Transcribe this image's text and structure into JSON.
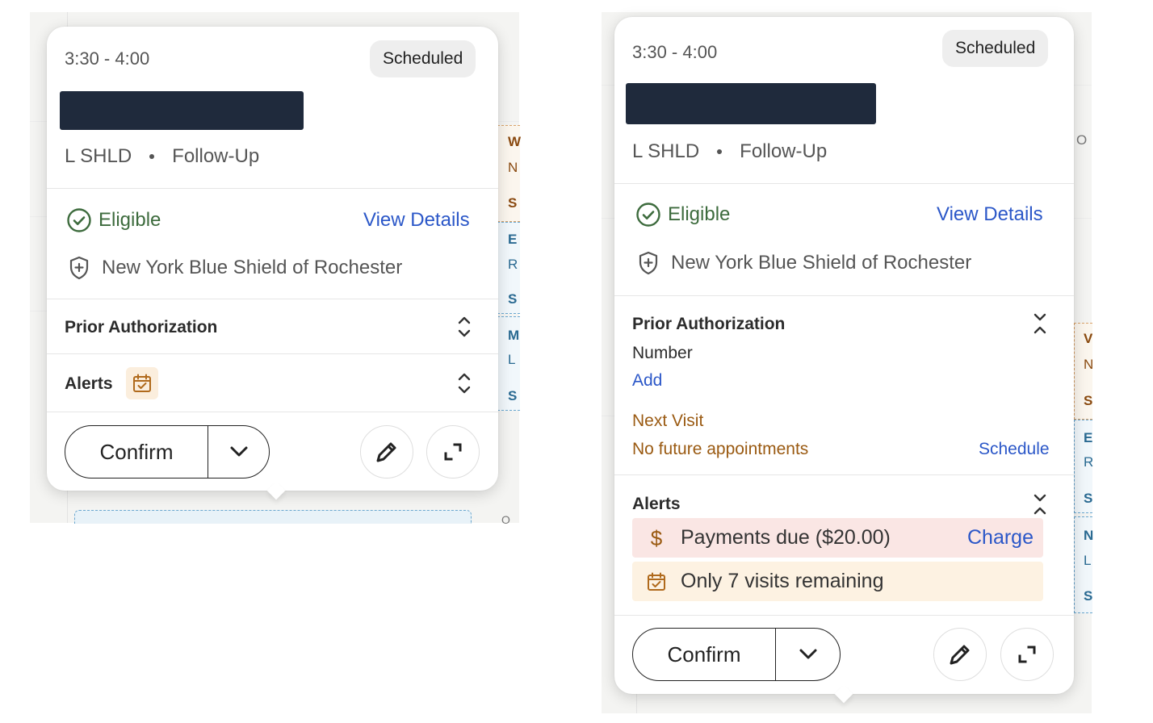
{
  "left_card": {
    "time": "3:30 - 4:00",
    "status": "Scheduled",
    "body_part": "L SHLD",
    "visit_type": "Follow-Up",
    "eligibility": "Eligible",
    "view_details": "View Details",
    "payer": "New York Blue Shield of Rochester",
    "prior_auth_title": "Prior Authorization",
    "alerts_title": "Alerts",
    "confirm_label": "Confirm",
    "expanded": false
  },
  "right_card": {
    "time": "3:30 - 4:00",
    "status": "Scheduled",
    "body_part": "L SHLD",
    "visit_type": "Follow-Up",
    "eligibility": "Eligible",
    "view_details": "View Details",
    "payer": "New York Blue Shield of Rochester",
    "prior_auth_title": "Prior Authorization",
    "number_label": "Number",
    "add_label": "Add",
    "next_visit_label": "Next Visit",
    "next_visit_value": "No future appointments",
    "schedule_label": "Schedule",
    "alerts_title": "Alerts",
    "payment_alert": "Payments due ($20.00)",
    "charge_label": "Charge",
    "visits_alert": "Only 7 visits remaining",
    "confirm_label": "Confirm",
    "expanded": true
  },
  "background_fragments": {
    "left": [
      "W",
      "N",
      "S",
      "E",
      "R",
      "S",
      "M",
      "L",
      "S"
    ],
    "left_bottom": "O",
    "right_top": "O",
    "right": [
      "V",
      "N",
      "S",
      "E",
      "R",
      "S",
      "N",
      "L",
      "S"
    ]
  },
  "colors": {
    "eligible_green": "#3d6b3d",
    "link_blue": "#2b57c8",
    "amber_text": "#9a5a12",
    "payment_bg": "#fae6e4",
    "visits_bg": "#fdf2e2",
    "redaction": "#1f2a3c"
  }
}
